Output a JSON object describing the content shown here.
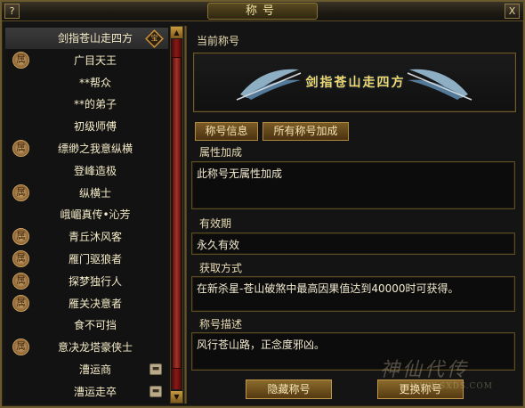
{
  "window": {
    "title": "称号",
    "help_label": "?",
    "close_label": "X"
  },
  "list": {
    "items": [
      {
        "label": "剑指苍山走四方",
        "badge": "宝",
        "type": "selected"
      },
      {
        "label": "广目天王",
        "badge": "属",
        "type": "badge"
      },
      {
        "label": "**帮众",
        "badge": "",
        "type": "plain"
      },
      {
        "label": "**的弟子",
        "badge": "",
        "type": "plain"
      },
      {
        "label": "初级师傅",
        "badge": "",
        "type": "plain"
      },
      {
        "label": "缥缈之我意纵横",
        "badge": "属",
        "type": "badge"
      },
      {
        "label": "登峰造极",
        "badge": "",
        "type": "plain"
      },
      {
        "label": "纵横士",
        "badge": "属",
        "type": "badge"
      },
      {
        "label": "峨嵋真传•沁芳",
        "badge": "",
        "type": "plain"
      },
      {
        "label": "青丘沐风客",
        "badge": "属",
        "type": "badge"
      },
      {
        "label": "雁门驱狼者",
        "badge": "属",
        "type": "badge"
      },
      {
        "label": "探梦独行人",
        "badge": "属",
        "type": "badge"
      },
      {
        "label": "雁关决意者",
        "badge": "属",
        "type": "badge"
      },
      {
        "label": "食不可挡",
        "badge": "",
        "type": "plain"
      },
      {
        "label": "意决龙塔豪侠士",
        "badge": "属",
        "type": "badge"
      },
      {
        "label": "漕运商",
        "badge": "",
        "type": "lock"
      },
      {
        "label": "漕运走卒",
        "badge": "",
        "type": "lock"
      }
    ]
  },
  "detail": {
    "current_label": "当前称号",
    "current_title": "剑指苍山走四方",
    "tab_info": "称号信息",
    "tab_all_bonus": "所有称号加成",
    "attr_label": "属性加成",
    "attr_value": "此称号无属性加成",
    "validity_label": "有效期",
    "validity_value": "永久有效",
    "obtain_label": "获取方式",
    "obtain_value": "在新杀星-苍山破煞中最高因果值达到40000时可获得。",
    "desc_label": "称号描述",
    "desc_value": "风行苍山路，正念度邪凶。"
  },
  "buttons": {
    "hide": "隐藏称号",
    "change": "更换称号"
  },
  "scroll": {
    "up_icon": "▲",
    "down_icon": "▼"
  },
  "watermark": {
    "text": "神仙代传",
    "url": "WWW.SXDS.COM"
  },
  "colors": {
    "frame_gold": "#6b5a2e",
    "title_gold": "#f3d86e",
    "scroll_red": "#a63226"
  }
}
